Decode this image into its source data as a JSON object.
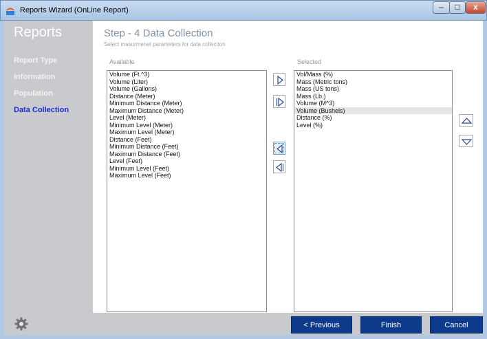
{
  "window": {
    "title": "Reports Wizard (OnLine Report)"
  },
  "sidebar": {
    "title": "Reports",
    "items": [
      {
        "label": "Report Type"
      },
      {
        "label": "Information"
      },
      {
        "label": "Population"
      },
      {
        "label": "Data Collection"
      }
    ],
    "active_index": 3
  },
  "step": {
    "title": "Step - 4  Data Collection",
    "subtitle": "Select masurmenet parameters for data collection"
  },
  "available": {
    "label": "Available",
    "items": [
      "Volume (Ft.^3)",
      "Volume (Liter)",
      "Volume (Gallons)",
      "Distance (Meter)",
      "Minimum Distance (Meter)",
      "Maximum Distance (Meter)",
      "Level (Meter)",
      "Minimum Level (Meter)",
      "Maximum Level (Meter)",
      "Distance (Feet)",
      "Minimum Distance (Feet)",
      "Maximum Distance (Feet)",
      "Level (Feet)",
      "Minimum Level (Feet)",
      "Maximum Level (Feet)"
    ]
  },
  "selected": {
    "label": "Selected",
    "items": [
      "Vol/Mass (%)",
      "Mass (Metric tons)",
      "Mass (US tons)",
      "Mass (Lb.)",
      "Volume (M^3)",
      "Volume (Bushels)",
      "Distance (%)",
      "Level (%)"
    ],
    "highlighted_index": 5
  },
  "footer": {
    "previous_label": "< Previous",
    "finish_label": "Finish",
    "cancel_label": "Cancel"
  },
  "icons": {
    "move_right": "triangle-right-icon",
    "move_all_right": "double-triangle-right-icon",
    "move_left": "triangle-left-icon",
    "move_all_left": "double-triangle-left-icon",
    "move_up": "triangle-up-icon",
    "move_down": "triangle-down-icon",
    "settings": "gear-icon"
  },
  "colors": {
    "nav_active": "#1a2ee0",
    "button_bg": "#0e3a8c",
    "sidebar_bg": "#c9cacd"
  }
}
